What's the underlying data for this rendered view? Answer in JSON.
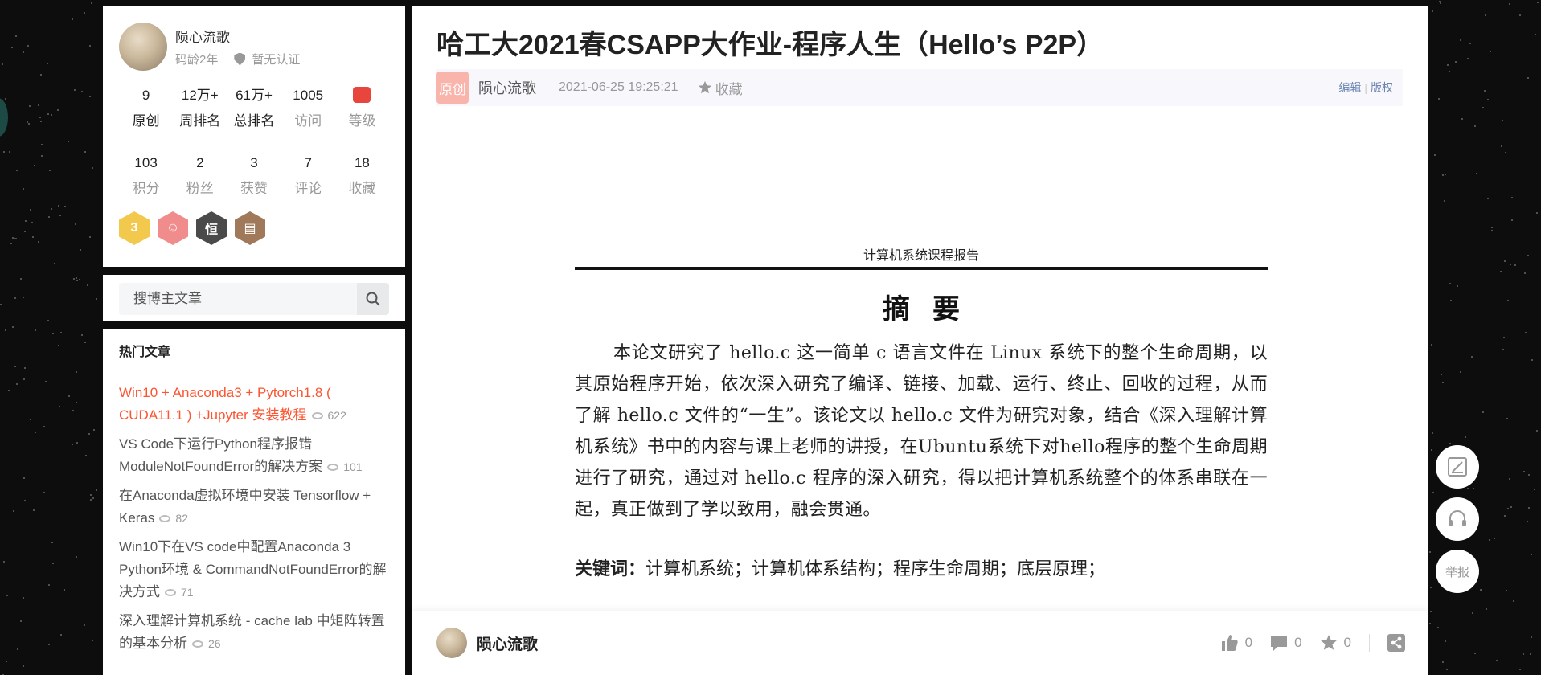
{
  "sidebar": {
    "profile": {
      "name": "陨心流歌",
      "code_age": "码龄2年",
      "cert": "暂无认证",
      "stats_row1": [
        {
          "num": "9",
          "label": "原创"
        },
        {
          "num": "12万+",
          "label": "周排名"
        },
        {
          "num": "61万+",
          "label": "总排名"
        },
        {
          "num": "1005",
          "label": "访问"
        },
        {
          "num": "",
          "label": "等级"
        }
      ],
      "stats_row2": [
        {
          "num": "103",
          "label": "积分"
        },
        {
          "num": "2",
          "label": "粉丝"
        },
        {
          "num": "3",
          "label": "获赞"
        },
        {
          "num": "7",
          "label": "评论"
        },
        {
          "num": "18",
          "label": "收藏"
        }
      ],
      "badges": [
        {
          "text": "3",
          "color": "#f2c94c"
        },
        {
          "text": "☺",
          "color": "#f08c8c"
        },
        {
          "text": "恒",
          "color": "#4a4a4a"
        },
        {
          "text": "▤",
          "color": "#a0785a"
        }
      ]
    },
    "search": {
      "placeholder": "搜博主文章"
    },
    "hot": {
      "title": "热门文章",
      "items": [
        {
          "title": "Win10 + Anaconda3 + Pytorch1.8 ( CUDA11.1 ) +Jupyter 安装教程",
          "views": "622"
        },
        {
          "title": "VS Code下运行Python程序报错ModuleNotFoundError的解决方案",
          "views": "101"
        },
        {
          "title": "在Anaconda虚拟环境中安装 Tensorflow + Keras",
          "views": "82"
        },
        {
          "title": "Win10下在VS code中配置Anaconda 3 Python环境 & CommandNotFoundError的解决方式",
          "views": "71"
        },
        {
          "title": "深入理解计算机系统 - cache lab 中矩阵转置的基本分析",
          "views": "26"
        }
      ]
    }
  },
  "article": {
    "title": "哈工大2021春CSAPP大作业-程序人生（Hello’s P2P）",
    "tag": "原创",
    "author": "陨心流歌",
    "date": "2021-06-25 19:25:21",
    "favorite": "收藏",
    "edit": "编辑",
    "copyright": "版权",
    "doc": {
      "header": "计算机系统课程报告",
      "heading": "摘要",
      "body": "本论文研究了 hello.c 这一简单 c 语言文件在 Linux 系统下的整个生命周期，以其原始程序开始，依次深入研究了编译、链接、加载、运行、终止、回收的过程，从而了解 hello.c 文件的“一生”。该论文以 hello.c 文件为研究对象，结合《深入理解计算机系统》书中的内容与课上老师的讲授，在Ubuntu系统下对hello程序的整个生命周期进行了研究，通过对 hello.c 程序的深入研究，得以把计算机系统整个的体系串联在一起，真正做到了学以致用，融会贯通。",
      "keywords_label": "关键词：",
      "keywords": "计算机系统；计算机体系结构；程序生命周期；底层原理；"
    }
  },
  "bottom_bar": {
    "author": "陨心流歌",
    "likes": "0",
    "comments": "0",
    "favorites": "0"
  },
  "float_tools": {
    "report": "举报"
  }
}
